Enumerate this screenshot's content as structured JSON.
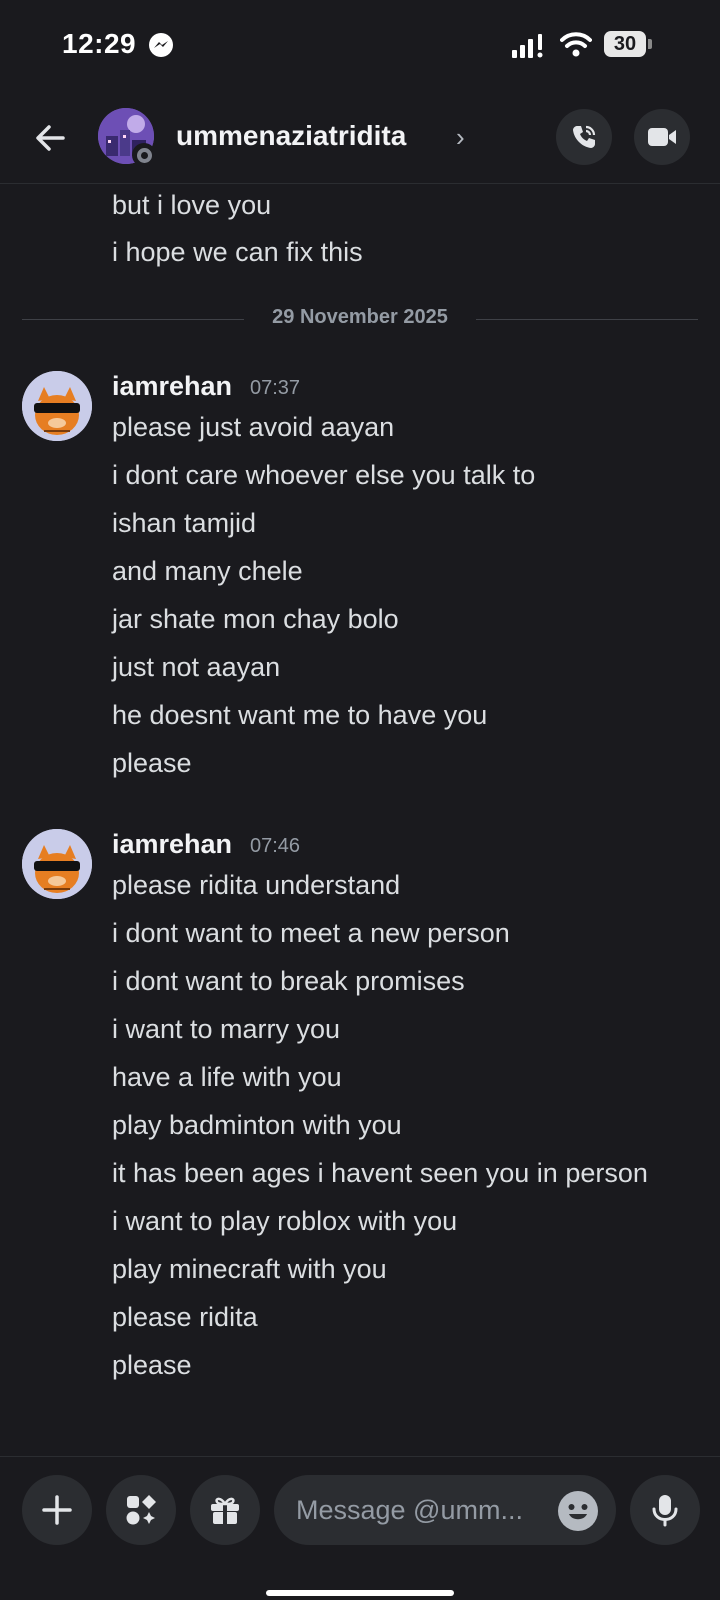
{
  "status_bar": {
    "time": "12:29",
    "battery": "30",
    "icons": [
      "messenger-icon",
      "signal-icon",
      "wifi-icon",
      "battery-icon"
    ]
  },
  "header": {
    "username": "ummenaziatridita",
    "chevron": "›",
    "icons": [
      "back-arrow-icon",
      "voice-call-icon",
      "video-call-icon"
    ]
  },
  "messages": {
    "previous_lines": [
      "but i love you",
      "i hope we can fix this"
    ],
    "date_divider": "29 November 2025",
    "groups": [
      {
        "author": "iamrehan",
        "time": "07:37",
        "lines": [
          "please just avoid aayan",
          "i dont care whoever else you talk to",
          "ishan tamjid",
          "and many chele",
          "jar shate mon chay bolo",
          "just not aayan",
          "he doesnt want me to have you",
          "please"
        ]
      },
      {
        "author": "iamrehan",
        "time": "07:46",
        "lines": [
          "please ridita understand",
          "i dont want to meet a new person",
          "i dont want to break promises",
          "i want to marry you",
          "have a life with you",
          "play badminton with you",
          "it has been ages i havent seen you in person",
          "i want to play roblox with you",
          "play minecraft with you",
          "please ridita",
          "please"
        ]
      }
    ]
  },
  "input_bar": {
    "placeholder": "Message @umm...",
    "icons": [
      "plus-icon",
      "apps-icon",
      "gift-icon",
      "emoji-icon",
      "microphone-icon"
    ]
  }
}
